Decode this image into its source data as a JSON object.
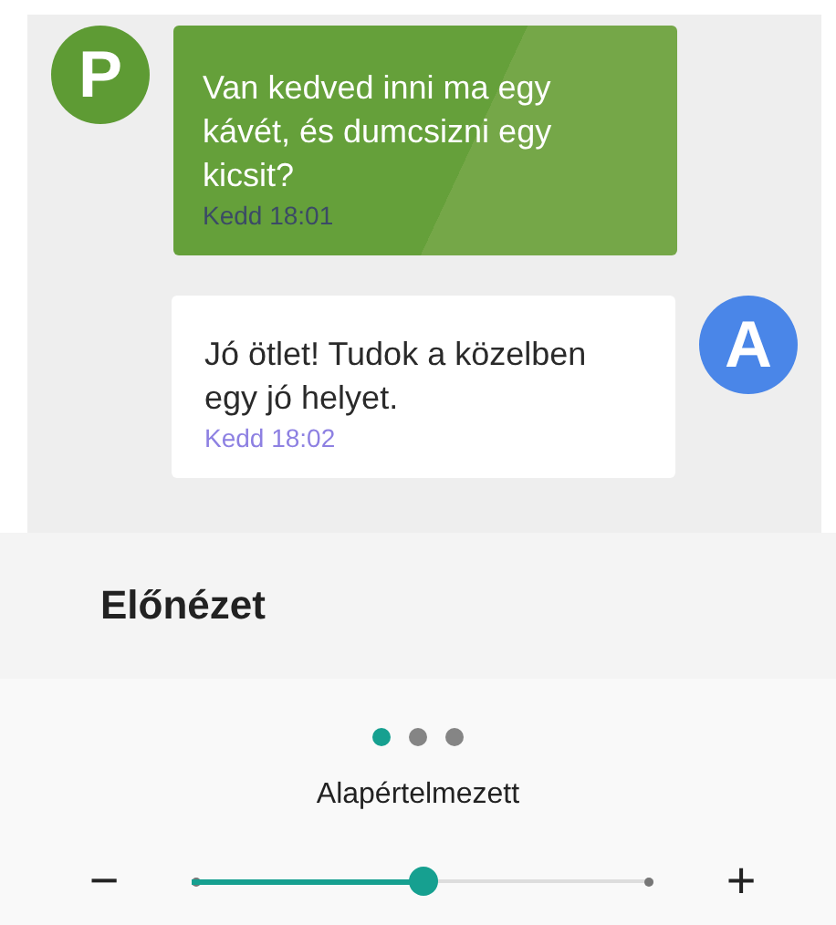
{
  "preview": {
    "messages": [
      {
        "kind": "left",
        "avatar": "P",
        "color": "#5e9b34",
        "text": "Van kedved inni ma egy kávét, és dumcsizni egy kicsit?",
        "time": "Kedd 18:01"
      },
      {
        "kind": "right",
        "avatar": "A",
        "color": "#4a86e8",
        "text": "Jó ötlet! Tudok a közelben egy jó helyet.",
        "time": "Kedd 18:02"
      }
    ]
  },
  "title": "Előnézet",
  "pages": [
    {
      "selected": true
    },
    {
      "selected": false
    },
    {
      "selected": false
    }
  ],
  "size_label": "Alapértelmezett",
  "slider": {
    "minus": "−",
    "plus": "+",
    "level": 0.5
  }
}
